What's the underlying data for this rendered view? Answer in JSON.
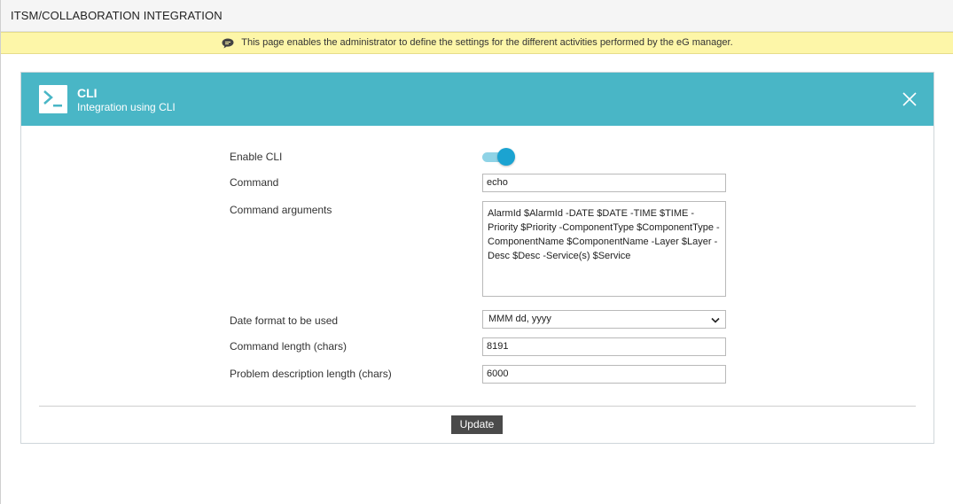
{
  "header": {
    "title": "ITSM/COLLABORATION INTEGRATION"
  },
  "info": {
    "text": "This page enables the administrator to define the settings for the different activities performed by the eG manager."
  },
  "panel": {
    "title": "CLI",
    "subtitle": "Integration using CLI",
    "icon": "terminal-icon",
    "accent_color": "#49b6c6"
  },
  "form": {
    "enable_cli": {
      "label": "Enable CLI",
      "enabled": true
    },
    "command": {
      "label": "Command",
      "value": "echo"
    },
    "command_arguments": {
      "label": "Command arguments",
      "value": "AlarmId $AlarmId -DATE $DATE -TIME $TIME -Priority $Priority -ComponentType $ComponentType -ComponentName $ComponentName -Layer $Layer -Desc $Desc -Service(s) $Service"
    },
    "date_format": {
      "label": "Date format to be used",
      "value": "MMM dd, yyyy"
    },
    "command_length": {
      "label": "Command length (chars)",
      "value": "8191"
    },
    "problem_desc_length": {
      "label": "Problem description length (chars)",
      "value": "6000"
    }
  },
  "actions": {
    "update_label": "Update"
  }
}
